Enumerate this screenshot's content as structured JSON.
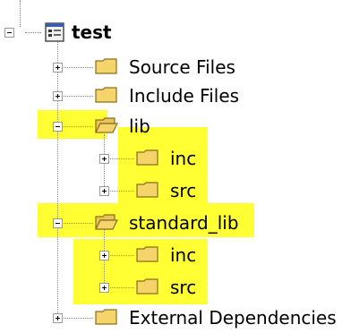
{
  "tree": {
    "root": {
      "label": "test",
      "expanded": true
    },
    "items": [
      {
        "label": "Source Files",
        "expanded": false,
        "highlighted": false
      },
      {
        "label": "Include Files",
        "expanded": false,
        "highlighted": false
      },
      {
        "label": "lib",
        "expanded": true,
        "highlighted": true,
        "children": [
          {
            "label": "inc",
            "expanded": false,
            "highlighted": true
          },
          {
            "label": "src",
            "expanded": false,
            "highlighted": true
          }
        ]
      },
      {
        "label": "standard_lib",
        "expanded": true,
        "highlighted": true,
        "children": [
          {
            "label": "inc",
            "expanded": false,
            "highlighted": true
          },
          {
            "label": "src",
            "expanded": false,
            "highlighted": true
          }
        ]
      },
      {
        "label": "External Dependencies",
        "expanded": false,
        "highlighted": false
      }
    ]
  },
  "colors": {
    "highlight": "#ffff33",
    "folder_fill": "#f5d46b",
    "folder_stroke": "#8a6d1c",
    "connector": "#8a8a8a"
  },
  "icons": {
    "root": "project-icon",
    "folder_closed": "folder-icon",
    "folder_open": "folder-open-icon",
    "expand": "plus-box-icon",
    "collapse": "minus-box-icon"
  }
}
